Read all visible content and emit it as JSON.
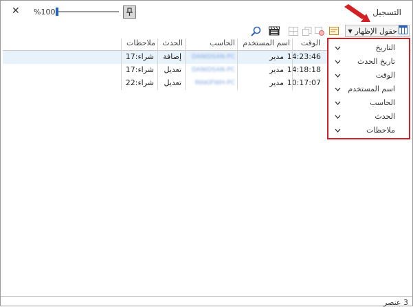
{
  "window": {
    "title": "التسجيل",
    "zoom": "%100",
    "zoom_fraction": 0.0
  },
  "toolbar": {
    "fields_label": "حقول الإظهار"
  },
  "table": {
    "headers": [
      "الوقت",
      "اسم المستخدم",
      "الحاسب",
      "الحدث",
      "ملاحظات"
    ],
    "rows": [
      {
        "time": "14:23:46",
        "user": "مدير",
        "computer": "DANIDSAN-PC",
        "event": "إضافة",
        "notes": "شراء:17"
      },
      {
        "time": "14:18:18",
        "user": "مدير",
        "computer": "DANIDSAN-PC",
        "event": "تعديل",
        "notes": "شراء:17"
      },
      {
        "time": "10:17:07",
        "user": "مدير",
        "computer": "MAKIFWH-PC",
        "event": "تعديل",
        "notes": "شراء:22"
      }
    ]
  },
  "fields_dropdown": {
    "items": [
      "التاريخ",
      "تاريخ الحدث",
      "الوقت",
      "اسم المستخدم",
      "الحاسب",
      "الحدث",
      "ملاحظات"
    ]
  },
  "status": {
    "count": "3 عنصر"
  },
  "colors": {
    "highlight": "#d32024",
    "accent": "#1e63c8",
    "selected_row": "#e8f2fb"
  }
}
